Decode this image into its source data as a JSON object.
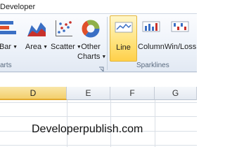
{
  "tabs": {
    "active": "Developer"
  },
  "ribbon": {
    "charts_group": {
      "label": "arts",
      "buttons": [
        {
          "id": "bar",
          "label": "Bar",
          "has_dropdown": true,
          "icon": "bar-chart-icon"
        },
        {
          "id": "area",
          "label": "Area",
          "has_dropdown": true,
          "icon": "area-chart-icon"
        },
        {
          "id": "scatter",
          "label": "Scatter",
          "has_dropdown": true,
          "icon": "scatter-chart-icon"
        },
        {
          "id": "other",
          "label_line1": "Other",
          "label_line2": "Charts",
          "has_dropdown": true,
          "icon": "doughnut-chart-icon"
        }
      ]
    },
    "sparklines_group": {
      "label": "Sparklines",
      "buttons": [
        {
          "id": "line",
          "label": "Line",
          "active": true,
          "icon": "line-sparkline-icon"
        },
        {
          "id": "column",
          "label": "Column",
          "icon": "column-sparkline-icon"
        },
        {
          "id": "winloss",
          "label": "Win/Loss",
          "icon": "winloss-sparkline-icon"
        }
      ]
    }
  },
  "sheet": {
    "columns": [
      "D",
      "E",
      "F",
      "G"
    ],
    "selected_column": "D"
  },
  "watermark": "Developerpublish.com",
  "colors": {
    "accent_gold": "#ffd04a",
    "ribbon_bg": "#eef3fa",
    "blue": "#3a6fc4",
    "red": "#c8312b"
  }
}
